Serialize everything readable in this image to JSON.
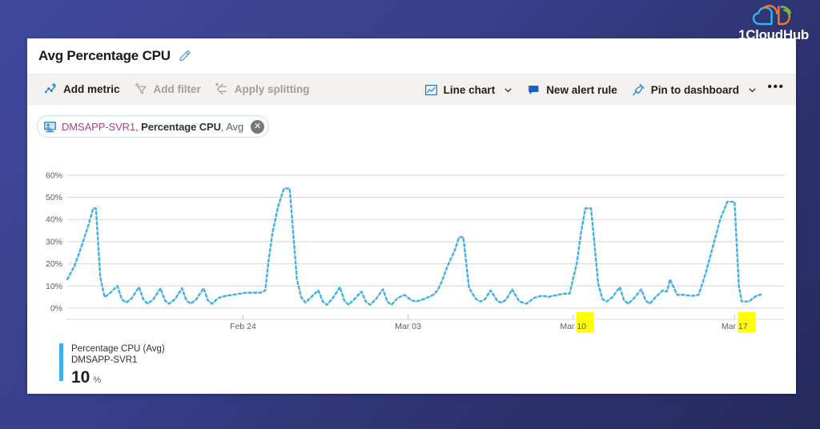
{
  "brand": {
    "name": "1CloudHub",
    "logo_icon": "cloud-logo-icon",
    "colors": {
      "cloud": "#35b4e8",
      "arc_orange": "#f07c28",
      "arc_green": "#7dbb42"
    }
  },
  "background": {
    "gradient_from": "#3f4a9e",
    "gradient_to": "#262a5e"
  },
  "header": {
    "title": "Avg Percentage CPU",
    "edit_icon": "pencil-icon"
  },
  "command_bar": {
    "left_items": [
      {
        "label": "Add metric",
        "icon": "add-metric-icon",
        "disabled": false
      },
      {
        "label": "Add filter",
        "icon": "add-filter-icon",
        "disabled": true
      },
      {
        "label": "Apply splitting",
        "icon": "apply-splitting-icon",
        "disabled": true
      }
    ],
    "right_items": [
      {
        "label": "Line chart",
        "icon": "line-chart-icon",
        "has_chevron": true
      },
      {
        "label": "New alert rule",
        "icon": "alert-rule-icon",
        "has_chevron": false
      },
      {
        "label": "Pin to dashboard",
        "icon": "pin-icon",
        "has_chevron": true
      }
    ],
    "more_label": "•••"
  },
  "metric_chip": {
    "icon": "monitor-icon",
    "resource": "DMSAPP-SVR1",
    "separator1": ", ",
    "metric": "Percentage CPU",
    "separator2": ", ",
    "aggregation": "Avg",
    "close_icon": "close-icon",
    "close_glyph": "✕"
  },
  "legend": {
    "swatch_color": "#3fb0e8",
    "metric_line": "Percentage CPU (Avg)",
    "resource_line": "DMSAPP-SVR1",
    "value": "10",
    "unit": "%"
  },
  "chart_data": {
    "type": "line",
    "title": "Avg Percentage CPU",
    "xlabel": "",
    "ylabel": "",
    "ylim": [
      0,
      65
    ],
    "xlim": [
      0,
      100
    ],
    "grid": true,
    "line_color": "#3fb0e8",
    "line_style": "dashed",
    "legend_position": "bottom-left",
    "ytick_labels": [
      "0%",
      "10%",
      "20%",
      "30%",
      "40%",
      "50%",
      "60%"
    ],
    "ytick_values": [
      0,
      10,
      20,
      30,
      40,
      50,
      60
    ],
    "xtick_labels": [
      "Feb 24",
      "Mar 03",
      "Mar 10",
      "Mar 17"
    ],
    "xtick_positions": [
      24.5,
      47.5,
      70.5,
      93.0
    ],
    "xtick_highlight": [
      {
        "label": "Mar 10",
        "highlighted_part": "10",
        "color": "#ffff00"
      },
      {
        "label": "Mar 17",
        "highlighted_part": "17",
        "color": "#ffff00"
      }
    ],
    "series": [
      {
        "name": "Percentage CPU (Avg)",
        "resource": "DMSAPP-SVR1",
        "unit": "%",
        "x": [
          0.0,
          1.0,
          2.0,
          3.0,
          3.6,
          4.0,
          4.6,
          5.2,
          6.0,
          7.0,
          7.6,
          8.2,
          9.0,
          10.0,
          10.6,
          11.2,
          12.0,
          13.0,
          13.6,
          14.2,
          15.0,
          16.0,
          16.6,
          17.2,
          18.0,
          19.0,
          19.6,
          20.2,
          21.0,
          22.0,
          23.0,
          24.0,
          25.0,
          26.0,
          27.0,
          27.6,
          28.0,
          28.6,
          29.4,
          30.2,
          31.0,
          32.0,
          32.6,
          33.2,
          34.0,
          35.0,
          35.6,
          36.2,
          37.0,
          38.0,
          38.6,
          39.2,
          40.0,
          41.0,
          41.6,
          42.2,
          43.0,
          44.0,
          44.6,
          45.2,
          46.0,
          47.0,
          48.0,
          48.6,
          49.2,
          50.0,
          51.0,
          51.6,
          52.2,
          53.0,
          54.0,
          54.6,
          55.2,
          56.0,
          57.0,
          57.6,
          58.2,
          59.0,
          60.0,
          60.6,
          61.2,
          62.0,
          63.0,
          64.0,
          65.0,
          66.0,
          66.6,
          67.0,
          67.6,
          68.4,
          69.2,
          70.0,
          71.0,
          71.6,
          72.2,
          73.0,
          74.0,
          74.6,
          75.2,
          76.0,
          77.0,
          77.6,
          78.2,
          79.0,
          80.0,
          80.6,
          81.2,
          82.0,
          83.0,
          83.6,
          84.0,
          85.0,
          86.0,
          87.0,
          88.0,
          89.0,
          90.0,
          91.0,
          92.0,
          93.0,
          93.6,
          94.0,
          95.0,
          96.0,
          97.0
        ],
        "y": [
          13.0,
          19.0,
          28.0,
          38.0,
          45.0,
          45.0,
          14.0,
          5.0,
          7.0,
          10.0,
          4.0,
          2.5,
          4.5,
          9.5,
          4.0,
          2.0,
          4.0,
          9.0,
          3.5,
          2.0,
          4.0,
          9.0,
          3.5,
          2.0,
          4.0,
          9.0,
          3.5,
          2.0,
          4.5,
          5.5,
          6.0,
          6.5,
          7.0,
          7.0,
          7.0,
          8.0,
          20.0,
          34.0,
          46.0,
          54.0,
          54.0,
          13.0,
          5.0,
          2.5,
          5.0,
          8.0,
          3.0,
          1.5,
          4.5,
          9.5,
          3.5,
          1.5,
          4.0,
          7.5,
          3.0,
          1.5,
          4.0,
          8.5,
          3.0,
          1.5,
          4.5,
          6.0,
          3.5,
          3.0,
          3.5,
          4.5,
          6.0,
          8.0,
          12.0,
          19.0,
          26.0,
          32.0,
          32.0,
          9.0,
          4.0,
          3.0,
          4.0,
          8.0,
          3.0,
          2.5,
          4.0,
          8.5,
          3.0,
          2.0,
          4.5,
          5.5,
          5.5,
          5.0,
          5.5,
          6.0,
          6.5,
          6.5,
          20.0,
          34.0,
          45.0,
          45.0,
          11.0,
          4.0,
          3.0,
          5.0,
          9.5,
          3.5,
          2.0,
          4.5,
          8.5,
          3.5,
          2.0,
          5.0,
          8.0,
          7.5,
          13.0,
          6.0,
          6.0,
          5.5,
          6.0,
          16.0,
          28.0,
          40.0,
          48.0,
          48.0,
          10.0,
          3.0,
          3.0,
          5.5,
          6.5
        ]
      }
    ]
  }
}
